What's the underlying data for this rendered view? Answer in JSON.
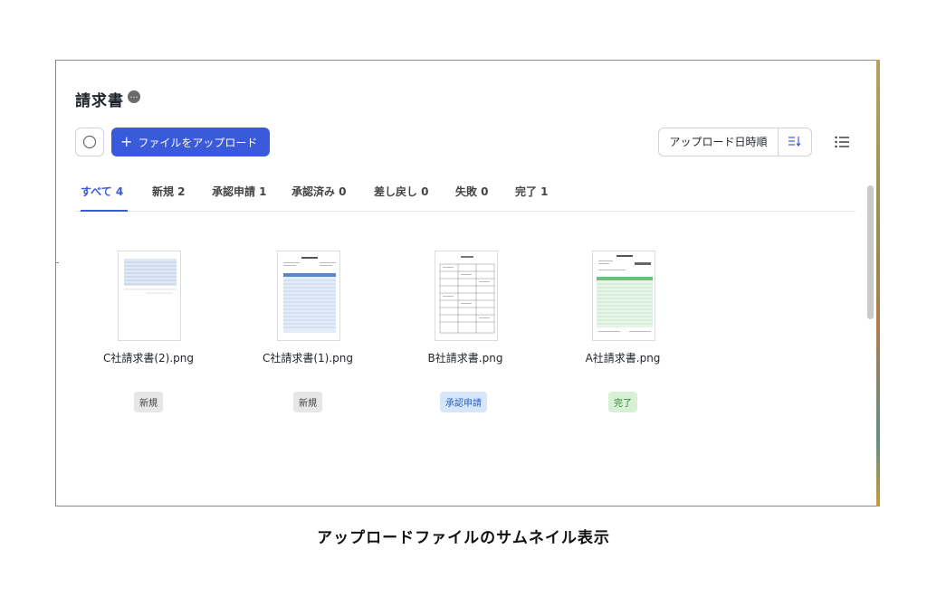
{
  "page": {
    "title": "請求書",
    "title_badge": "…",
    "upload_button": {
      "icon": "plus-icon",
      "label": "ファイルをアップロード"
    },
    "sort": {
      "label": "アップロード日時順",
      "icon": "sort-descending-icon"
    },
    "view_toggle_icon": "list-view-icon"
  },
  "tabs": [
    {
      "label": "すべて 4",
      "active": true
    },
    {
      "label": "新規 2",
      "active": false
    },
    {
      "label": "承認申請 1",
      "active": false
    },
    {
      "label": "承認済み 0",
      "active": false
    },
    {
      "label": "差し戻し 0",
      "active": false
    },
    {
      "label": "失敗 0",
      "active": false
    },
    {
      "label": "完了 1",
      "active": false
    }
  ],
  "files": [
    {
      "name": "C社請求書(2).png",
      "status": "新規",
      "status_color": "gray"
    },
    {
      "name": "C社請求書(1).png",
      "status": "新規",
      "status_color": "gray"
    },
    {
      "name": "B社請求書.png",
      "status": "承認申請",
      "status_color": "blue"
    },
    {
      "name": "A社請求書.png",
      "status": "完了",
      "status_color": "green"
    }
  ],
  "colors": {
    "accent": "#3a5bd9",
    "status_gray": "#e6e6e6",
    "status_blue": "#d6e6fb",
    "status_green": "#d8f1d5"
  },
  "caption": "アップロードファイルのサムネイル表示"
}
